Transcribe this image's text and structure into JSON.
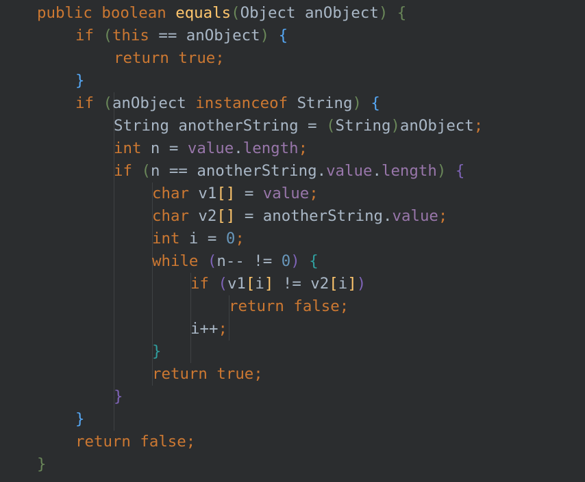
{
  "editor": {
    "lines": [
      {
        "indent": 0,
        "tokens": [
          {
            "t": "public boolean ",
            "c": "kw"
          },
          {
            "t": "equals",
            "c": "fn"
          },
          {
            "t": "(",
            "c": "br1"
          },
          {
            "t": "Object anObject",
            "c": "plain"
          },
          {
            "t": ")",
            "c": "br1"
          },
          {
            "t": " ",
            "c": "plain"
          },
          {
            "t": "{",
            "c": "br1"
          }
        ]
      },
      {
        "indent": 1,
        "tokens": [
          {
            "t": "if ",
            "c": "kw"
          },
          {
            "t": "(",
            "c": "br1"
          },
          {
            "t": "this",
            "c": "kw"
          },
          {
            "t": " == anObject",
            "c": "plain"
          },
          {
            "t": ")",
            "c": "br1"
          },
          {
            "t": " ",
            "c": "plain"
          },
          {
            "t": "{",
            "c": "br2"
          }
        ]
      },
      {
        "indent": 2,
        "tokens": [
          {
            "t": "return true;",
            "c": "kw"
          }
        ]
      },
      {
        "indent": 1,
        "tokens": [
          {
            "t": "}",
            "c": "br2"
          }
        ]
      },
      {
        "indent": 1,
        "tokens": [
          {
            "t": "if ",
            "c": "kw"
          },
          {
            "t": "(",
            "c": "br1"
          },
          {
            "t": "anObject ",
            "c": "plain"
          },
          {
            "t": "instanceof ",
            "c": "kw"
          },
          {
            "t": "String",
            "c": "plain"
          },
          {
            "t": ")",
            "c": "br1"
          },
          {
            "t": " ",
            "c": "plain"
          },
          {
            "t": "{",
            "c": "br2"
          }
        ]
      },
      {
        "indent": 2,
        "tokens": [
          {
            "t": "String anotherString = ",
            "c": "plain"
          },
          {
            "t": "(",
            "c": "br1"
          },
          {
            "t": "String",
            "c": "plain"
          },
          {
            "t": ")",
            "c": "br1"
          },
          {
            "t": "anObject",
            "c": "plain"
          },
          {
            "t": ";",
            "c": "kw"
          }
        ]
      },
      {
        "indent": 2,
        "tokens": [
          {
            "t": "int ",
            "c": "kw"
          },
          {
            "t": "n = ",
            "c": "plain"
          },
          {
            "t": "value",
            "c": "fld"
          },
          {
            "t": ".",
            "c": "plain"
          },
          {
            "t": "length",
            "c": "fld"
          },
          {
            "t": ";",
            "c": "kw"
          }
        ]
      },
      {
        "indent": 2,
        "tokens": [
          {
            "t": "if ",
            "c": "kw"
          },
          {
            "t": "(",
            "c": "br1"
          },
          {
            "t": "n == anotherString.",
            "c": "plain"
          },
          {
            "t": "value",
            "c": "fld"
          },
          {
            "t": ".",
            "c": "plain"
          },
          {
            "t": "length",
            "c": "fld"
          },
          {
            "t": ")",
            "c": "br1"
          },
          {
            "t": " ",
            "c": "plain"
          },
          {
            "t": "{",
            "c": "br4"
          }
        ]
      },
      {
        "indent": 3,
        "tokens": [
          {
            "t": "char ",
            "c": "kw"
          },
          {
            "t": "v1",
            "c": "plain"
          },
          {
            "t": "[]",
            "c": "fn"
          },
          {
            "t": " = ",
            "c": "plain"
          },
          {
            "t": "value",
            "c": "fld"
          },
          {
            "t": ";",
            "c": "kw"
          }
        ]
      },
      {
        "indent": 3,
        "tokens": [
          {
            "t": "char ",
            "c": "kw"
          },
          {
            "t": "v2",
            "c": "plain"
          },
          {
            "t": "[]",
            "c": "fn"
          },
          {
            "t": " = anotherString.",
            "c": "plain"
          },
          {
            "t": "value",
            "c": "fld"
          },
          {
            "t": ";",
            "c": "kw"
          }
        ]
      },
      {
        "indent": 3,
        "tokens": [
          {
            "t": "int ",
            "c": "kw"
          },
          {
            "t": "i = ",
            "c": "plain"
          },
          {
            "t": "0",
            "c": "num"
          },
          {
            "t": ";",
            "c": "kw"
          }
        ]
      },
      {
        "indent": 3,
        "tokens": [
          {
            "t": "while ",
            "c": "kw"
          },
          {
            "t": "(",
            "c": "br4"
          },
          {
            "t": "n-- != ",
            "c": "plain"
          },
          {
            "t": "0",
            "c": "num"
          },
          {
            "t": ")",
            "c": "br4"
          },
          {
            "t": " ",
            "c": "plain"
          },
          {
            "t": "{",
            "c": "br3"
          }
        ]
      },
      {
        "indent": 4,
        "tokens": [
          {
            "t": "if ",
            "c": "kw"
          },
          {
            "t": "(",
            "c": "br4"
          },
          {
            "t": "v1",
            "c": "plain"
          },
          {
            "t": "[",
            "c": "fn"
          },
          {
            "t": "i",
            "c": "plain"
          },
          {
            "t": "]",
            "c": "fn"
          },
          {
            "t": " != v2",
            "c": "plain"
          },
          {
            "t": "[",
            "c": "fn"
          },
          {
            "t": "i",
            "c": "plain"
          },
          {
            "t": "]",
            "c": "fn"
          },
          {
            "t": ")",
            "c": "br4"
          }
        ]
      },
      {
        "indent": 5,
        "tokens": [
          {
            "t": "return false;",
            "c": "kw"
          }
        ]
      },
      {
        "indent": 4,
        "tokens": [
          {
            "t": "i++",
            "c": "plain"
          },
          {
            "t": ";",
            "c": "kw"
          }
        ]
      },
      {
        "indent": 3,
        "tokens": [
          {
            "t": "}",
            "c": "br3"
          }
        ]
      },
      {
        "indent": 3,
        "tokens": [
          {
            "t": "return true;",
            "c": "kw"
          }
        ]
      },
      {
        "indent": 2,
        "tokens": [
          {
            "t": "}",
            "c": "br4"
          }
        ]
      },
      {
        "indent": 1,
        "tokens": [
          {
            "t": "}",
            "c": "br2"
          }
        ]
      },
      {
        "indent": 1,
        "tokens": [
          {
            "t": "return false;",
            "c": "kw"
          }
        ]
      },
      {
        "indent": 0,
        "tokens": [
          {
            "t": "}",
            "c": "br1"
          }
        ]
      }
    ],
    "indent_guides": [
      {
        "level": 2,
        "from": 4,
        "to": 18
      },
      {
        "level": 3,
        "from": 8,
        "to": 16
      },
      {
        "level": 4,
        "from": 12,
        "to": 15
      },
      {
        "level": 5,
        "from": 13,
        "to": 14
      }
    ],
    "colors": {
      "background": "#2b2d2f",
      "keyword": "#cc7832",
      "method": "#ffc66d",
      "field": "#9876aa",
      "number": "#6897bb",
      "text": "#a9b7c6"
    }
  }
}
